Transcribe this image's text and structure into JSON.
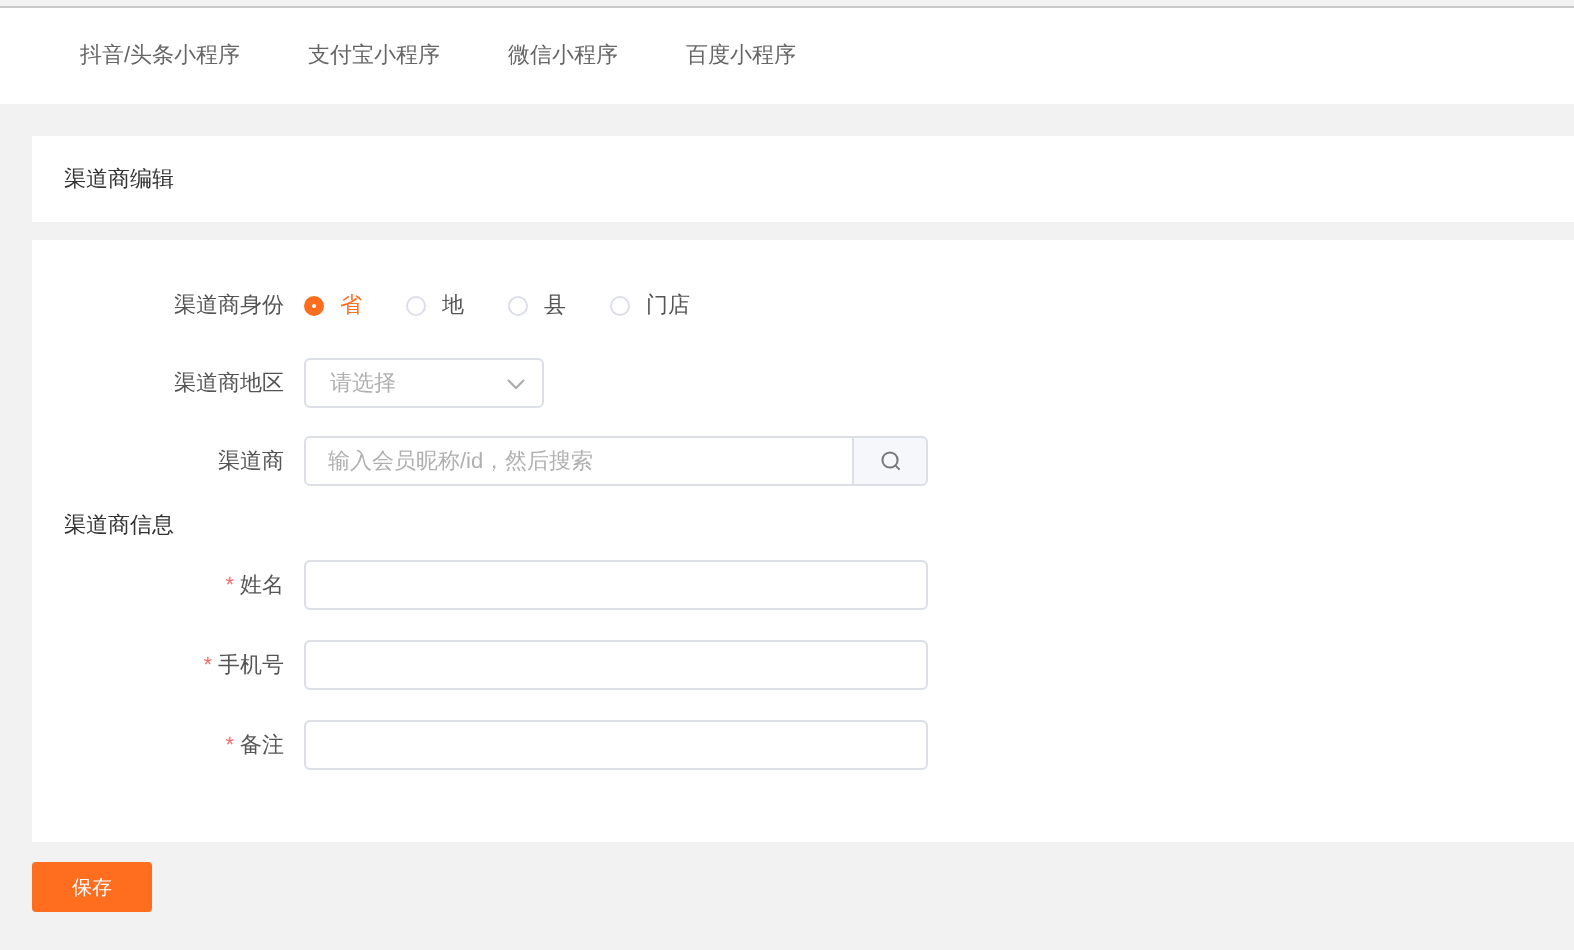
{
  "tabs": [
    {
      "label": "抖音/头条小程序",
      "selected": false
    },
    {
      "label": "支付宝小程序",
      "selected": false
    },
    {
      "label": "微信小程序",
      "selected": false
    },
    {
      "label": "百度小程序",
      "selected": false
    }
  ],
  "card_title": "渠道商编辑",
  "identity": {
    "label": "渠道商身份",
    "options": [
      {
        "label": "省",
        "selected": true
      },
      {
        "label": "地",
        "selected": false
      },
      {
        "label": "县",
        "selected": false
      },
      {
        "label": "门店",
        "selected": false
      }
    ]
  },
  "region": {
    "label": "渠道商地区",
    "placeholder": "请选择"
  },
  "dealer": {
    "label": "渠道商",
    "placeholder": "输入会员昵称/id，然后搜索"
  },
  "section_title": "渠道商信息",
  "fields": [
    {
      "label": "姓名",
      "required_mark": "*"
    },
    {
      "label": "手机号",
      "required_mark": "*"
    },
    {
      "label": "备注",
      "required_mark": "*"
    }
  ],
  "save_button": "保存"
}
